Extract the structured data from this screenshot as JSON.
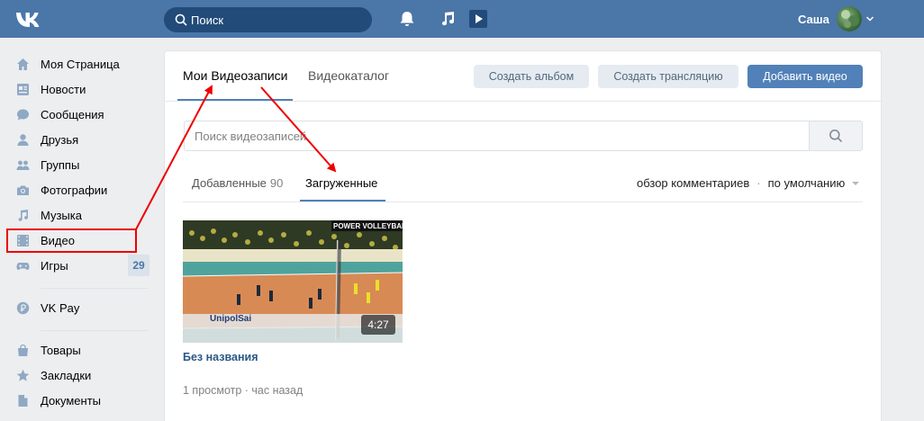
{
  "header": {
    "search_placeholder": "Поиск",
    "user_name": "Саша",
    "icons": [
      "vk-logo-icon",
      "search-icon",
      "bell-icon",
      "music-note-icon",
      "play-icon",
      "chevron-down-icon"
    ]
  },
  "sidebar": {
    "items": [
      {
        "label": "Моя Страница",
        "icon": "home-icon"
      },
      {
        "label": "Новости",
        "icon": "news-icon"
      },
      {
        "label": "Сообщения",
        "icon": "messages-icon"
      },
      {
        "label": "Друзья",
        "icon": "friend-icon"
      },
      {
        "label": "Группы",
        "icon": "groups-icon"
      },
      {
        "label": "Фотографии",
        "icon": "camera-icon"
      },
      {
        "label": "Музыка",
        "icon": "music-note-icon"
      },
      {
        "label": "Видео",
        "icon": "film-icon"
      },
      {
        "label": "Игры",
        "icon": "gamepad-icon",
        "badge": "29"
      },
      {
        "label": "VK Pay",
        "icon": "ruble-icon"
      },
      {
        "label": "Товары",
        "icon": "bag-icon"
      },
      {
        "label": "Закладки",
        "icon": "star-icon"
      },
      {
        "label": "Документы",
        "icon": "document-icon"
      }
    ]
  },
  "main": {
    "tabs": [
      {
        "label": "Мои Видеозаписи"
      },
      {
        "label": "Видеокаталог"
      }
    ],
    "buttons": {
      "create_album": "Создать альбом",
      "create_stream": "Создать трансляцию",
      "add_video": "Добавить видео"
    },
    "search_placeholder": "Поиск видеозаписей",
    "subtabs": [
      {
        "label": "Добавленные",
        "count": "90"
      },
      {
        "label": "Загруженные"
      }
    ],
    "sorting": {
      "comments": "обзор комментариев",
      "separator": "·",
      "order": "по умолчанию"
    },
    "video": {
      "title": "Без названия",
      "duration": "4:27",
      "meta": "1 просмотр · час назад",
      "thumb_banner": "POWER VOLLEYBALL"
    }
  },
  "colors": {
    "header": "#4a76a8",
    "accent": "#5181b8",
    "annotation": "#e00000",
    "link": "#2a5885"
  }
}
